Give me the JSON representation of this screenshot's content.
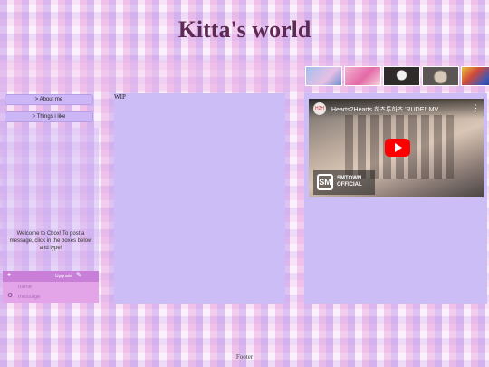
{
  "site": {
    "title": "Kitta's world"
  },
  "banner": {
    "thumbnails": [
      {
        "icon": "anime-thumb-icon",
        "color": "#7fa6d9"
      },
      {
        "icon": "pink-hair-thumb-icon",
        "color": "#e88fc0"
      },
      {
        "icon": "scream-mask-thumb-icon",
        "color": "#3d3838"
      },
      {
        "icon": "hamster-thumb-icon",
        "color": "#6e6966"
      },
      {
        "icon": "colorful-art-thumb-icon",
        "color": "#3b56b8"
      }
    ]
  },
  "sidebar": {
    "nav": [
      {
        "label": "> About me"
      },
      {
        "label": "> Things i like"
      }
    ]
  },
  "cbox": {
    "welcome": "Welcome to Cbox! To post a message, click in the boxes below and type!",
    "upgrade_label": "Upgrade",
    "user_icon": "user-icon",
    "edit_icon": "edit-icon",
    "settings_icon": "settings-icon",
    "name_placeholder": "name",
    "message_placeholder": "message"
  },
  "main": {
    "wip": "WIP"
  },
  "video": {
    "title": "Hearts2Hearts 하츠투하츠 'RUDE!' MV",
    "channel_logo": "SMTOWN OFFICIAL",
    "logo_mark": "SM",
    "avatar_text": "H2H"
  },
  "footer": {
    "text": "Footer"
  },
  "colors": {
    "accent": "#cdbdf7",
    "title": "#5e2a55",
    "cbox_bar": "#c97fd8",
    "cbox_form": "#e3a4e8",
    "play_button": "#ff0000"
  }
}
